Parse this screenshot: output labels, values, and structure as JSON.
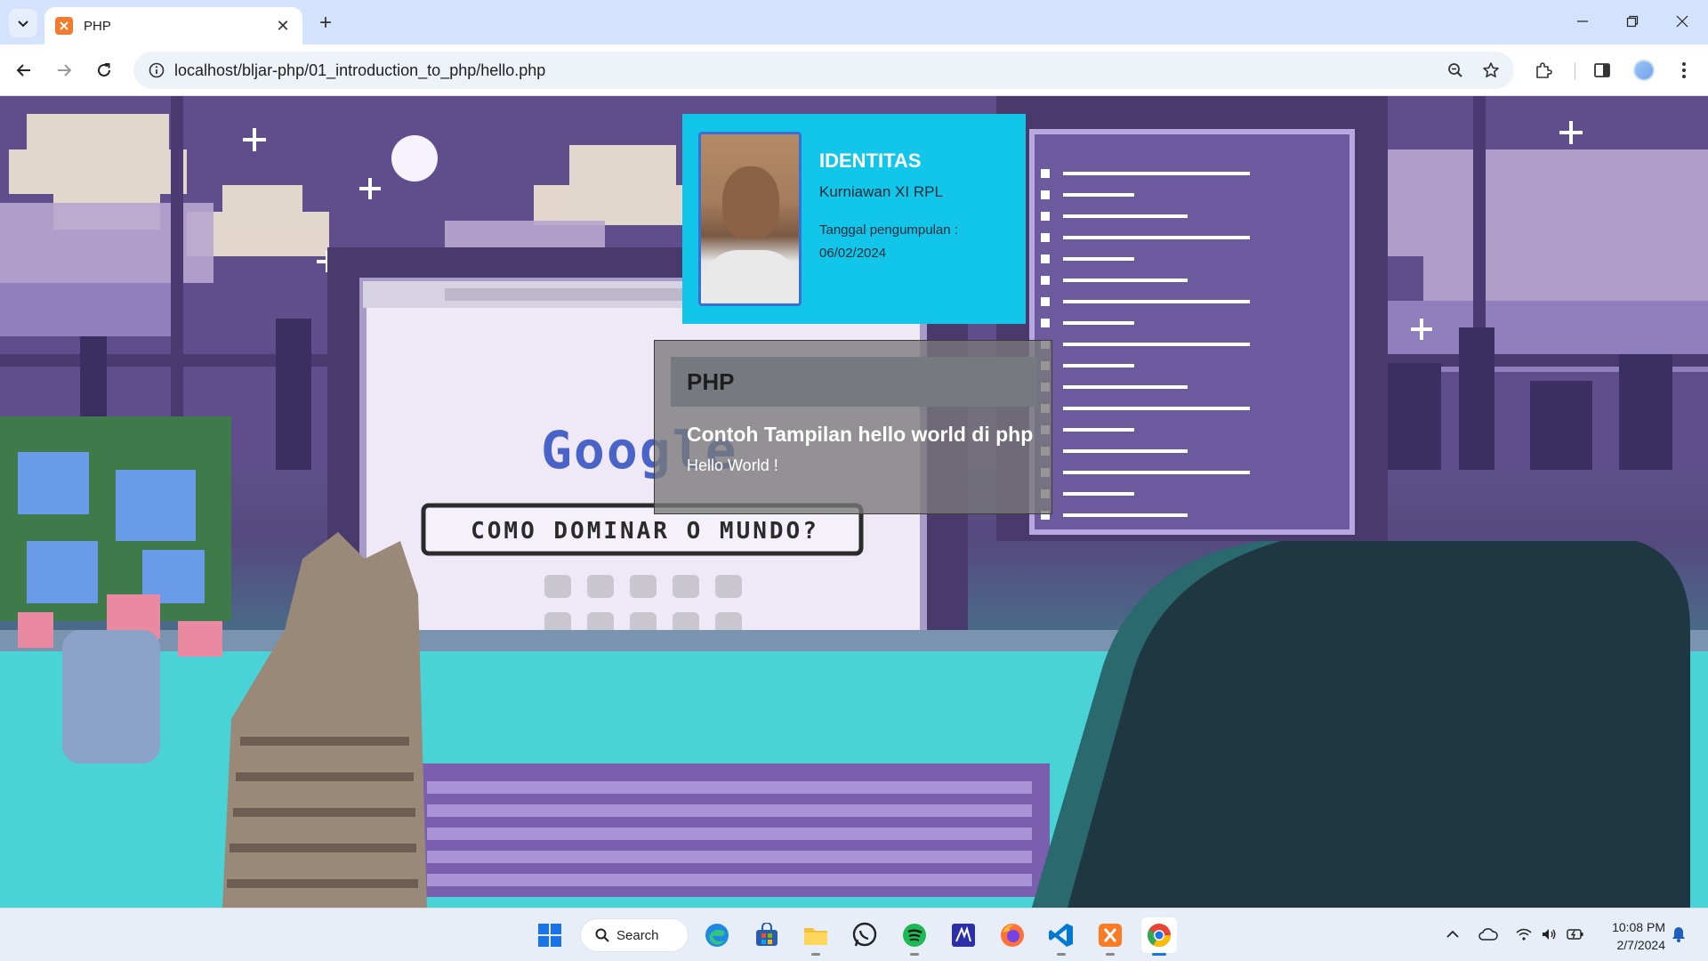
{
  "browser": {
    "tab_title": "PHP",
    "url": "localhost/bljar-php/01_introduction_to_php/hello.php",
    "new_tab_symbol": "+",
    "close_symbol": "✕"
  },
  "identitas": {
    "title": "IDENTITAS",
    "name": "Kurniawan XI RPL",
    "date_label": "Tanggal pengumpulan :",
    "date": "06/02/2024"
  },
  "php_card": {
    "header": "PHP",
    "title": "Contoh Tampilan hello world di php",
    "body": "Hello World !"
  },
  "background_text": {
    "logo": "Google",
    "search_bar": "COMO DOMINAR O MUNDO?"
  },
  "taskbar": {
    "search_label": "Search",
    "apps": [
      "start-icon",
      "edge-icon",
      "store-icon",
      "file-explorer-icon",
      "whatsapp-icon",
      "spotify-icon",
      "vscode-alt-icon",
      "firefox-icon",
      "vscode-icon",
      "xampp-icon",
      "chrome-icon"
    ],
    "time": "10:08 PM",
    "date": "2/7/2024"
  },
  "colors": {
    "card_identitas": "#12c6ea",
    "card_php": "#787878",
    "chrome_tabstrip": "#d3e3fd"
  }
}
